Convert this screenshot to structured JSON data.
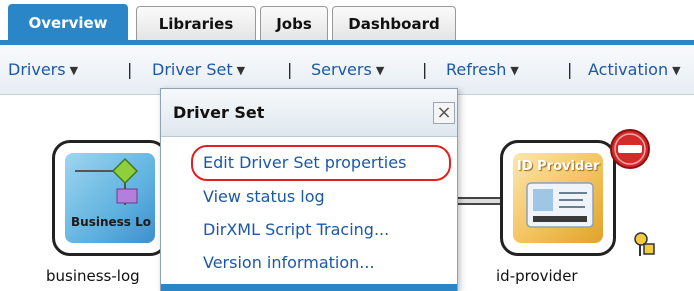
{
  "tabs": [
    {
      "label": "Overview",
      "active": true
    },
    {
      "label": "Libraries",
      "active": false
    },
    {
      "label": "Jobs",
      "active": false
    },
    {
      "label": "Dashboard",
      "active": false
    }
  ],
  "menubar": {
    "items": [
      "Drivers",
      "Driver Set",
      "Servers",
      "Refresh",
      "Activation"
    ],
    "separator": "|"
  },
  "popup": {
    "title": "Driver Set",
    "close_glyph": "×",
    "items": [
      "Edit Driver Set properties",
      "View status log",
      "DirXML Script Tracing...",
      "Version information..."
    ],
    "highlighted_item": "Edit Driver Set properties"
  },
  "nodes": {
    "left": {
      "label": "business-log",
      "image_text": "Business Lo"
    },
    "right": {
      "label": "id-provider",
      "image_text": "ID Provider",
      "badge": "stop-icon"
    }
  },
  "colors": {
    "accent": "#2a86c6",
    "link": "#1c58a8",
    "highlight": "#e02020",
    "stop": "#d42a2a"
  }
}
